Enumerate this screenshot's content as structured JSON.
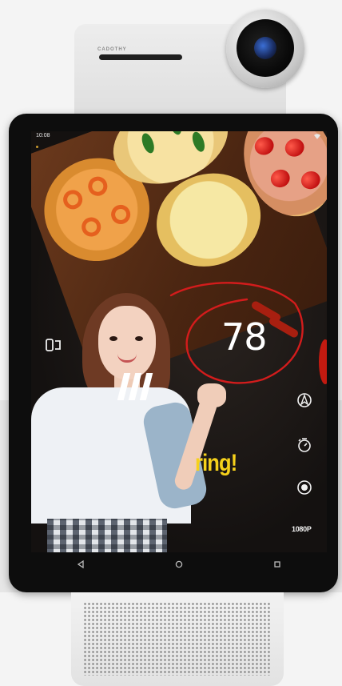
{
  "device": {
    "brand": "CADOTHY"
  },
  "status_bar": {
    "time": "10:08"
  },
  "screen": {
    "score_value": "78",
    "promo_text": "ring!",
    "resolution_label": "1080P"
  },
  "controls": [
    {
      "icon": "navigation-icon"
    },
    {
      "icon": "timer-icon"
    },
    {
      "icon": "record-icon"
    }
  ],
  "nav_bar": {
    "back_icon": "back-triangle-icon",
    "home_icon": "home-circle-icon",
    "recents_icon": "recents-square-icon"
  },
  "colors": {
    "accent_yellow": "#f6d11b",
    "annotation_red": "#d31c1c",
    "frame": "#0d0d0d"
  }
}
